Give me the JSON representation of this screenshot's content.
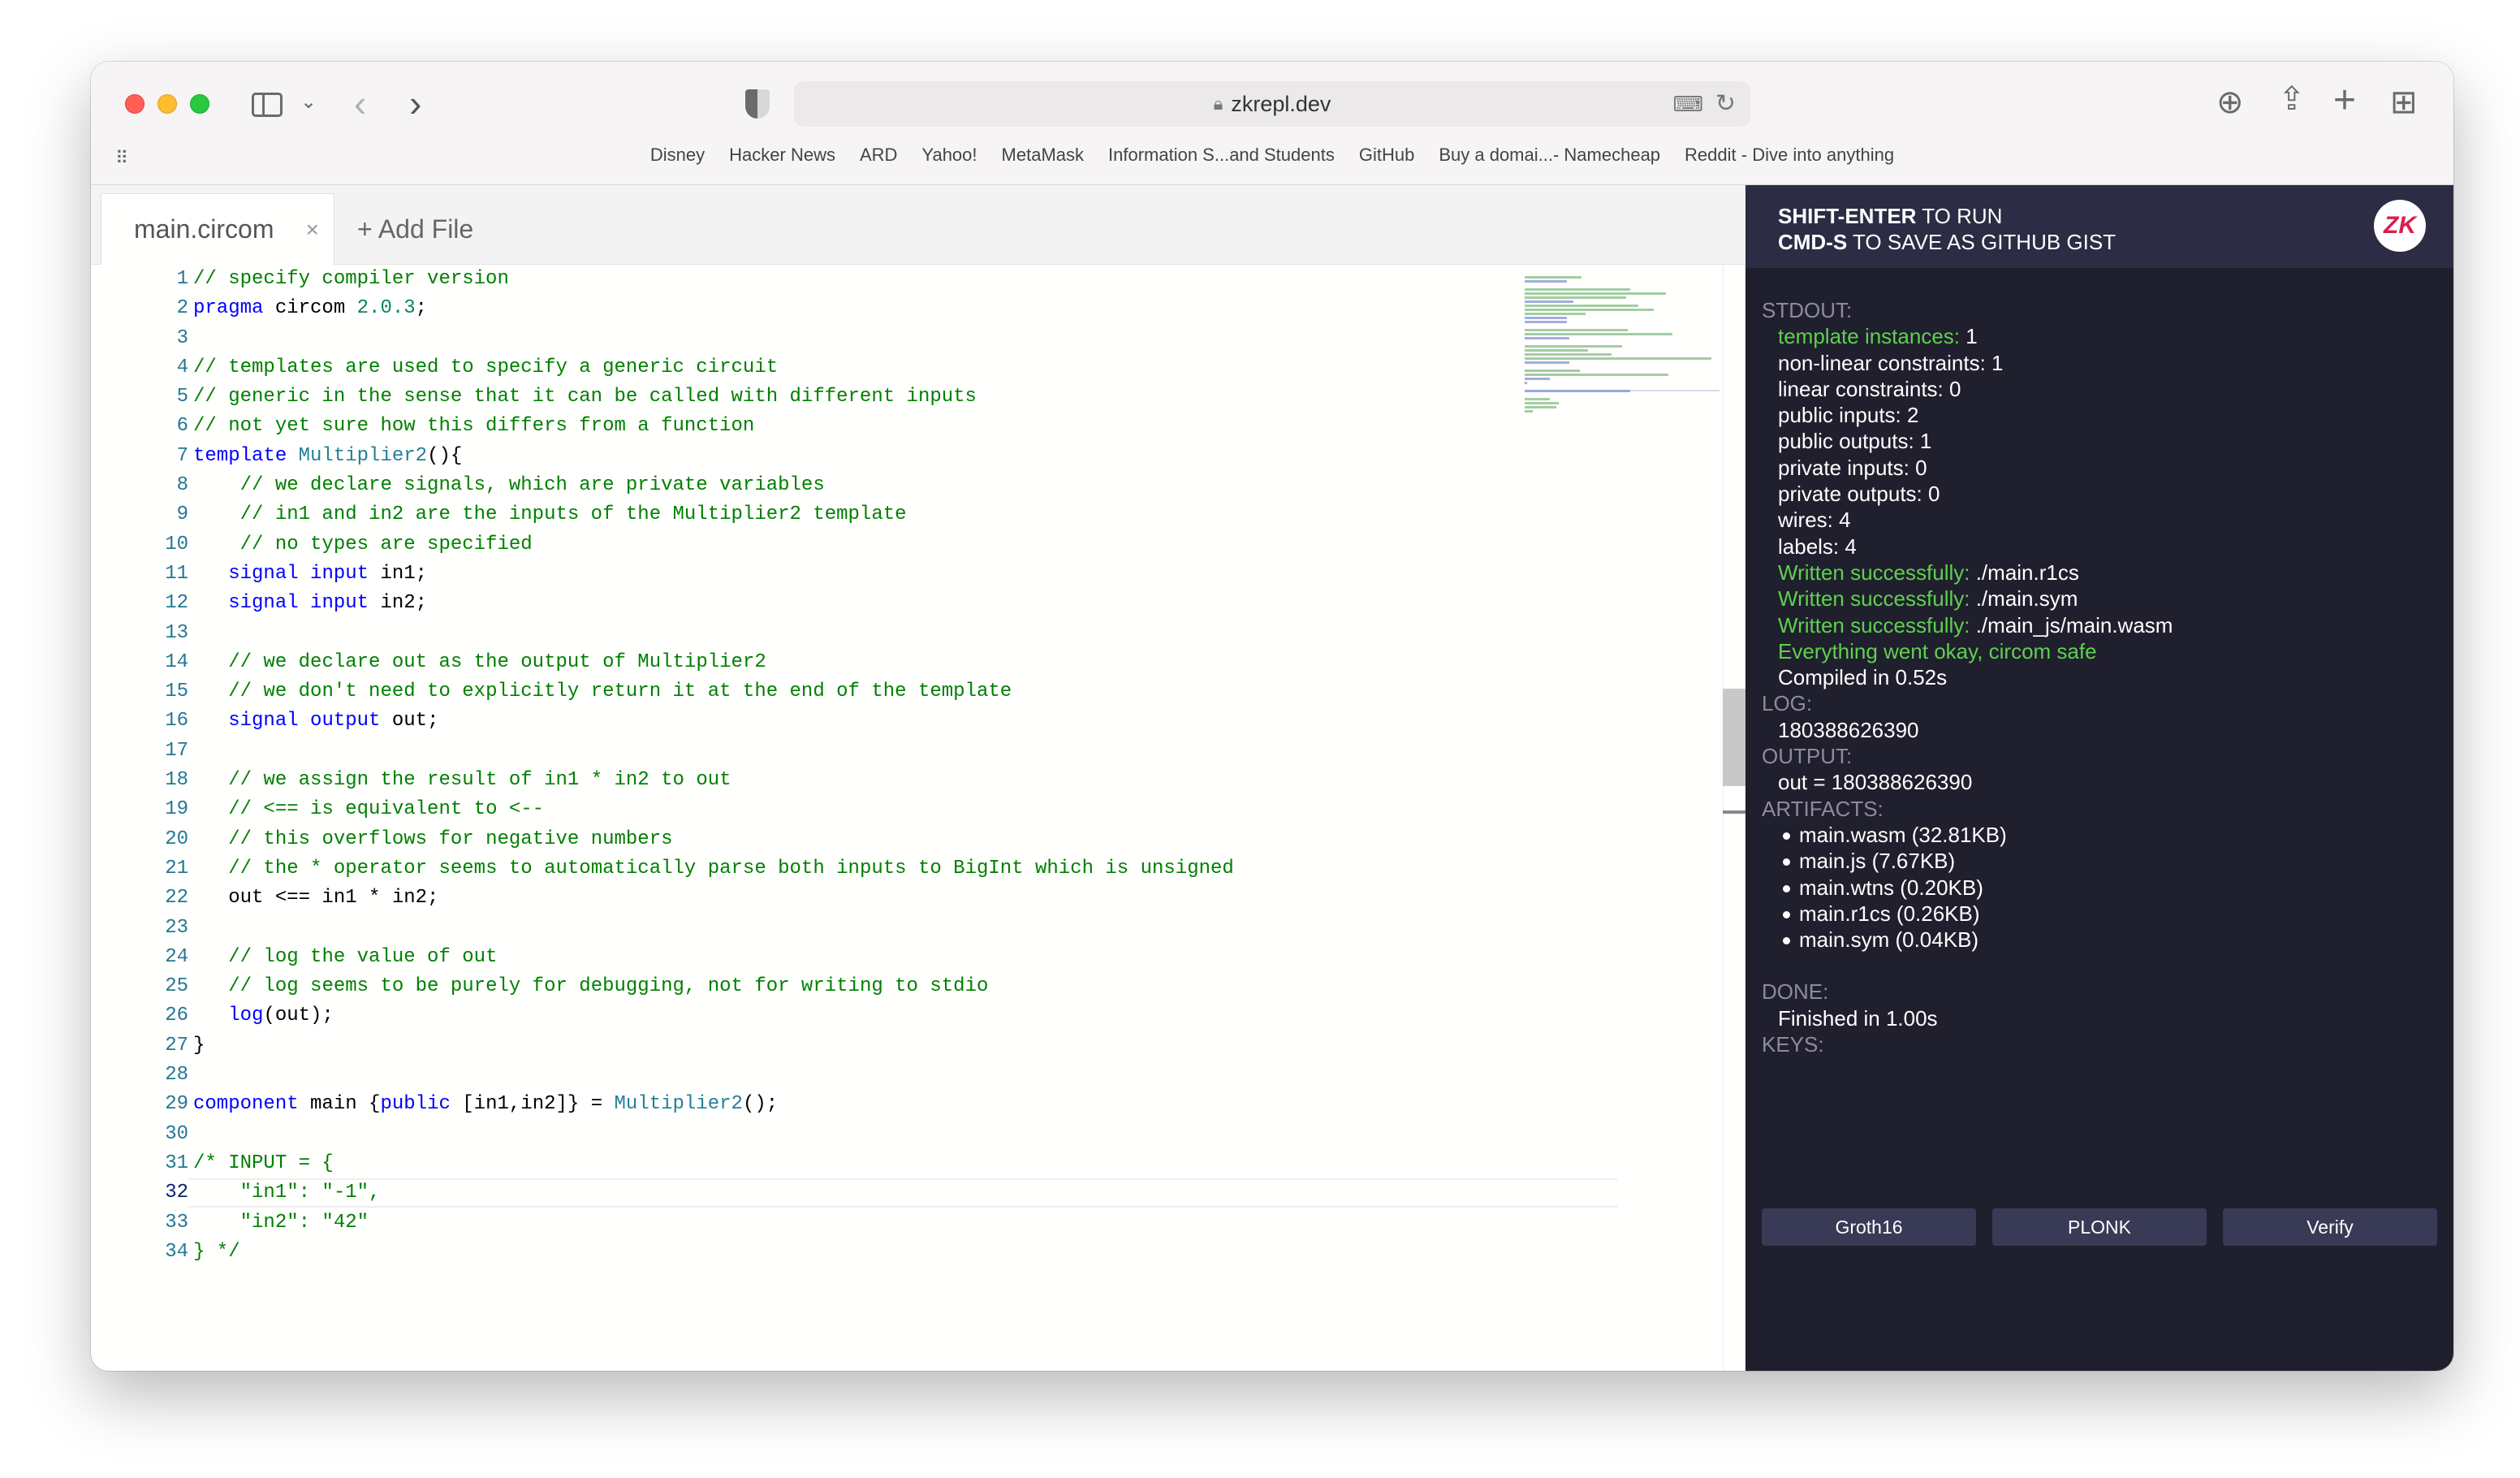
{
  "browser": {
    "url": "zkrepl.dev",
    "bookmarks": [
      "Disney",
      "Hacker News",
      "ARD",
      "Yahoo!",
      "MetaMask",
      "Information S...and Students",
      "GitHub",
      "Buy a domai...- Namecheap",
      "Reddit - Dive into anything"
    ]
  },
  "editor": {
    "tab_label": "main.circom",
    "tab_close": "×",
    "add_file_label": "+ Add File",
    "current_line": 32,
    "lines": [
      [
        [
          "c",
          "// specify compiler version"
        ]
      ],
      [
        [
          "k",
          "pragma"
        ],
        [
          "p",
          " circom "
        ],
        [
          "n",
          "2.0.3"
        ],
        [
          "p",
          ";"
        ]
      ],
      [],
      [
        [
          "c",
          "// templates are used to specify a generic circuit"
        ]
      ],
      [
        [
          "c",
          "// generic in the sense that it can be called with different inputs"
        ]
      ],
      [
        [
          "c",
          "// not yet sure how this differs from a function"
        ]
      ],
      [
        [
          "k",
          "template"
        ],
        [
          "p",
          " "
        ],
        [
          "t",
          "Multiplier2"
        ],
        [
          "p",
          "(){"
        ]
      ],
      [
        [
          "p",
          "    "
        ],
        [
          "c",
          "// we declare signals, which are private variables"
        ]
      ],
      [
        [
          "p",
          "    "
        ],
        [
          "c",
          "// in1 and in2 are the inputs of the Multiplier2 template"
        ]
      ],
      [
        [
          "p",
          "    "
        ],
        [
          "c",
          "// no types are specified"
        ]
      ],
      [
        [
          "p",
          "   "
        ],
        [
          "k",
          "signal"
        ],
        [
          "p",
          " "
        ],
        [
          "k",
          "input"
        ],
        [
          "p",
          " in1;"
        ]
      ],
      [
        [
          "p",
          "   "
        ],
        [
          "k",
          "signal"
        ],
        [
          "p",
          " "
        ],
        [
          "k",
          "input"
        ],
        [
          "p",
          " in2;"
        ]
      ],
      [],
      [
        [
          "p",
          "   "
        ],
        [
          "c",
          "// we declare out as the output of Multiplier2"
        ]
      ],
      [
        [
          "p",
          "   "
        ],
        [
          "c",
          "// we don't need to explicitly return it at the end of the template"
        ]
      ],
      [
        [
          "p",
          "   "
        ],
        [
          "k",
          "signal"
        ],
        [
          "p",
          " "
        ],
        [
          "k",
          "output"
        ],
        [
          "p",
          " out;"
        ]
      ],
      [],
      [
        [
          "p",
          "   "
        ],
        [
          "c",
          "// we assign the result of in1 * in2 to out"
        ]
      ],
      [
        [
          "p",
          "   "
        ],
        [
          "c",
          "// <== is equivalent to <--"
        ]
      ],
      [
        [
          "p",
          "   "
        ],
        [
          "c",
          "// this overflows for negative numbers"
        ]
      ],
      [
        [
          "p",
          "   "
        ],
        [
          "c",
          "// the * operator seems to automatically parse both inputs to BigInt which is unsigned"
        ]
      ],
      [
        [
          "p",
          "   out <== in1 * in2;"
        ]
      ],
      [],
      [
        [
          "p",
          "   "
        ],
        [
          "c",
          "// log the value of out"
        ]
      ],
      [
        [
          "p",
          "   "
        ],
        [
          "c",
          "// log seems to be purely for debugging, not for writing to stdio"
        ]
      ],
      [
        [
          "p",
          "   "
        ],
        [
          "k",
          "log"
        ],
        [
          "p",
          "(out);"
        ]
      ],
      [
        [
          "p",
          "}"
        ]
      ],
      [],
      [
        [
          "k",
          "component"
        ],
        [
          "p",
          " main {"
        ],
        [
          "k",
          "public"
        ],
        [
          "p",
          " [in1,in2]} = "
        ],
        [
          "t",
          "Multiplier2"
        ],
        [
          "p",
          "();"
        ]
      ],
      [],
      [
        [
          "c",
          "/* INPUT = {"
        ]
      ],
      [
        [
          "c",
          "    \"in1\": \"-1\","
        ]
      ],
      [
        [
          "c",
          "    \"in2\": \"42\""
        ]
      ],
      [
        [
          "c",
          "} */"
        ]
      ]
    ]
  },
  "panel": {
    "header_line1_bold": "SHIFT-ENTER",
    "header_line1_rest": " TO RUN",
    "header_line2_bold": "CMD-S",
    "header_line2_rest": " TO SAVE AS GITHUB GIST",
    "logo_text": "ZK",
    "stdout_label": "STDOUT:",
    "stdout": [
      {
        "g": "template instances:",
        "w": " 1"
      },
      {
        "g": "",
        "w": "non-linear constraints: 1"
      },
      {
        "g": "",
        "w": "linear constraints: 0"
      },
      {
        "g": "",
        "w": "public inputs: 2"
      },
      {
        "g": "",
        "w": "public outputs: 1"
      },
      {
        "g": "",
        "w": "private inputs: 0"
      },
      {
        "g": "",
        "w": "private outputs: 0"
      },
      {
        "g": "",
        "w": "wires: 4"
      },
      {
        "g": "",
        "w": "labels: 4"
      },
      {
        "g": "Written successfully:",
        "w": " ./main.r1cs"
      },
      {
        "g": "Written successfully:",
        "w": " ./main.sym"
      },
      {
        "g": "Written successfully:",
        "w": " ./main_js/main.wasm"
      },
      {
        "g": "Everything went okay, circom safe",
        "w": ""
      },
      {
        "g": "",
        "w": "Compiled in 0.52s"
      }
    ],
    "log_label": "LOG:",
    "log_value": "180388626390",
    "output_label": "OUTPUT:",
    "output_value": "out = 180388626390",
    "artifacts_label": "ARTIFACTS:",
    "artifacts": [
      "main.wasm (32.81KB)",
      "main.js (7.67KB)",
      "main.wtns (0.20KB)",
      "main.r1cs (0.26KB)",
      "main.sym (0.04KB)"
    ],
    "done_label": "DONE:",
    "done_value": "Finished in 1.00s",
    "keys_label": "KEYS:",
    "key_buttons": [
      "Groth16",
      "PLONK",
      "Verify"
    ]
  }
}
